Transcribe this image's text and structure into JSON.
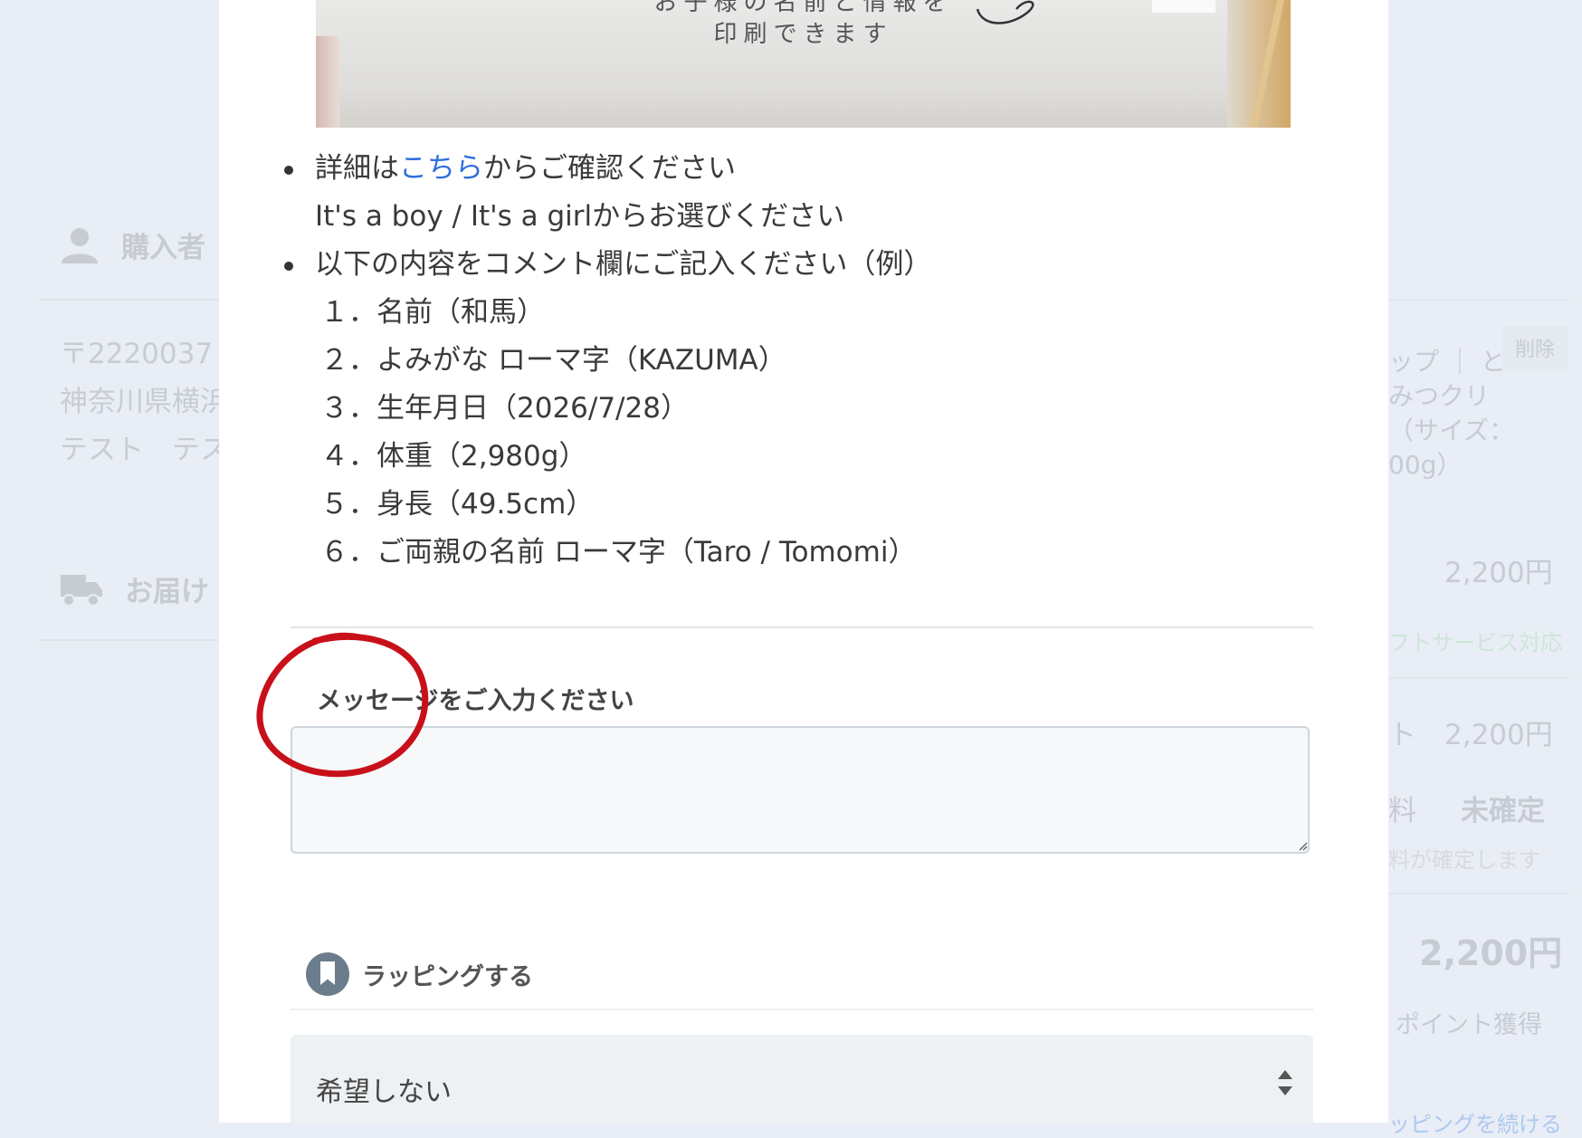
{
  "background": {
    "buyer_label": "購入者",
    "postal": "〒2220037",
    "address": "神奈川県横浜",
    "name": "テスト　テス",
    "delivery_label": "お届け",
    "delete_label": "削除",
    "product_line1": "ップ ｜ と",
    "product_line2": "みつクリ",
    "product_line3": "（サイズ：",
    "product_line4": "00g）",
    "price1": "2,200円",
    "gift_service": "フトサービス対応",
    "subtotal_prefix": "ト",
    "subtotal": "2,200円",
    "shipping_prefix": "料",
    "shipping_status": "未確定",
    "shipping_note": "料が確定します",
    "total": "2,200円",
    "points": "ポイント獲得",
    "continue_link": "ッピングを続ける"
  },
  "banner": {
    "line1": "お子様の名前と情報を",
    "line2": "印刷できます"
  },
  "instructions": {
    "detail_prefix": "詳細は",
    "detail_link": "こちら",
    "detail_suffix": "からご確認ください",
    "gender_note": "It's a boy / It's a girlからお選びください",
    "comment_note": "以下の内容をコメント欄にご記入ください（例）",
    "items": [
      "１．名前（和馬）",
      "２．よみがな ローマ字（KAZUMA）",
      "３．生年月日（2026/7/28）",
      "４．体重（2,980g）",
      "５．身長（49.5cm）",
      "６．ご両親の名前 ローマ字（Taro / Tomomi）"
    ]
  },
  "message": {
    "label": "メッセージをご入力ください",
    "value": ""
  },
  "wrapping": {
    "label": "ラッピングする",
    "selected": "希望しない"
  },
  "colors": {
    "link": "#2f6fdb",
    "annotation_circle": "#c8101a",
    "overlay_bg": "#e8edf6"
  }
}
